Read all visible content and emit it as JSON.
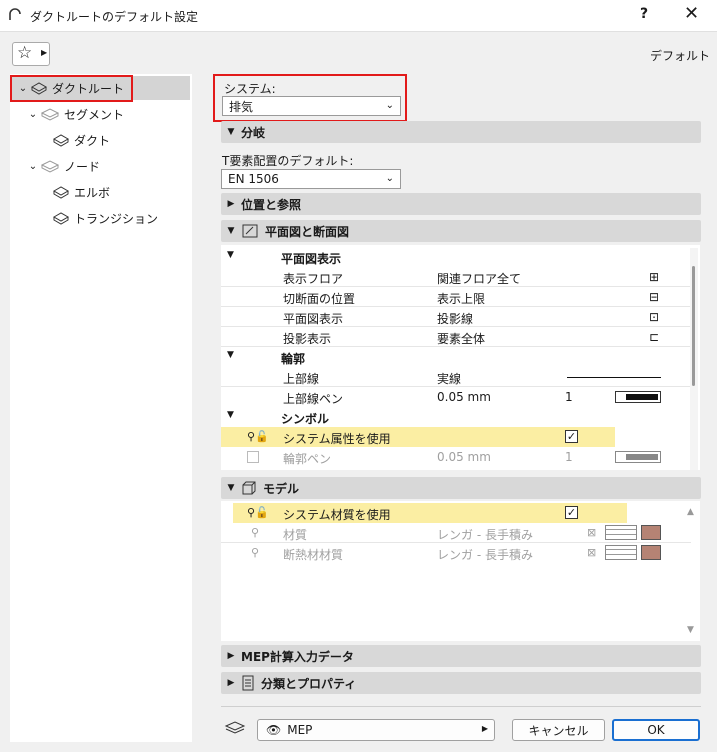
{
  "window": {
    "title": "ダクトルートのデフォルト設定",
    "help": "?",
    "close": "✕"
  },
  "favorites_label": "デフォルト",
  "tree": [
    {
      "label": "ダクトルート",
      "level": 0,
      "expanded": true,
      "selected": true
    },
    {
      "label": "セグメント",
      "level": 1,
      "expanded": true
    },
    {
      "label": "ダクト",
      "level": 2
    },
    {
      "label": "ノード",
      "level": 1,
      "expanded": true
    },
    {
      "label": "エルボ",
      "level": 2
    },
    {
      "label": "トランジション",
      "level": 2
    }
  ],
  "system": {
    "label": "システム:",
    "value": "排気"
  },
  "sections": {
    "branch": "分岐",
    "position": "位置と参照",
    "plan_section": "平面図と断面図",
    "model": "モデル",
    "mep_calc": "MEP計算入力データ",
    "classification": "分類とプロパティ"
  },
  "t_default": {
    "label": "T要素配置のデフォルト:",
    "value": "EN 1506"
  },
  "plan_table": {
    "groups": [
      {
        "title": "平面図表示",
        "rows": [
          {
            "name": "表示フロア",
            "value": "関連フロア全て"
          },
          {
            "name": "切断面の位置",
            "value": "表示上限"
          },
          {
            "name": "平面図表示",
            "value": "投影線"
          },
          {
            "name": "投影表示",
            "value": "要素全体"
          }
        ]
      },
      {
        "title": "輪郭",
        "rows": [
          {
            "name": "上部線",
            "value": "実線"
          },
          {
            "name": "上部線ペン",
            "value": "0.05 mm",
            "num": "1"
          }
        ]
      },
      {
        "title": "シンボル",
        "rows": [
          {
            "name": "システム属性を使用",
            "value": ""
          },
          {
            "name": "輪郭ペン",
            "value": "0.05 mm",
            "num": "1"
          }
        ]
      }
    ]
  },
  "model_table": {
    "rows": [
      {
        "name": "システム材質を使用",
        "value": ""
      },
      {
        "name": "材質",
        "value": "レンガ - 長手積み"
      },
      {
        "name": "断熱材材質",
        "value": "レンガ - 長手積み"
      }
    ]
  },
  "footer": {
    "mep_label": "MEP",
    "cancel": "キャンセル",
    "ok": "OK"
  },
  "colors": {
    "highlight": "#fbeea3",
    "red_frame": "#e21a1a",
    "swatch": "#b58374"
  }
}
